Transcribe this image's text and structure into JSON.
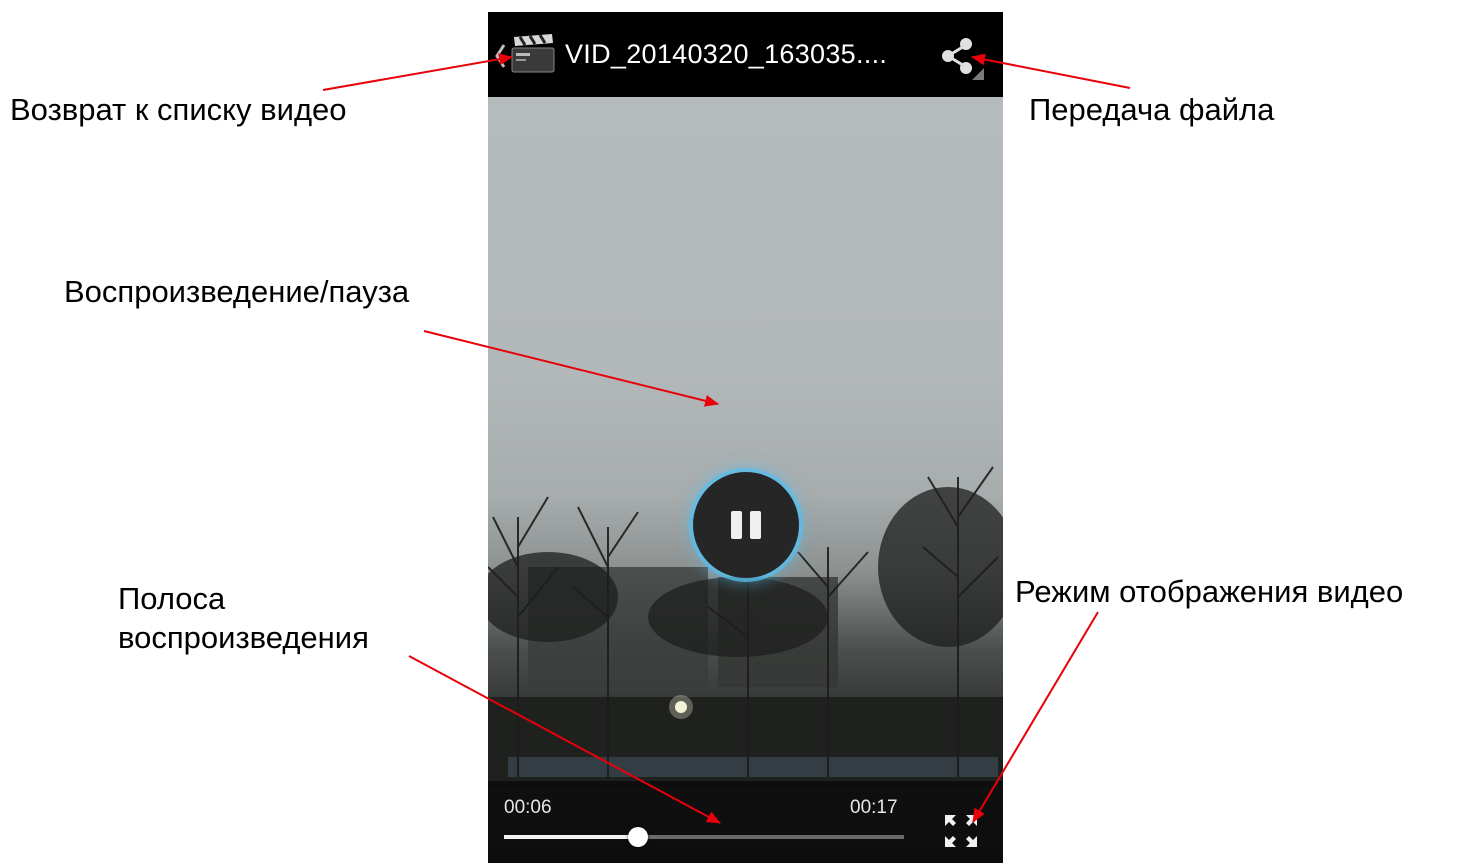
{
  "player": {
    "title": "VID_20140320_163035....",
    "time_elapsed": "00:06",
    "time_total": "00:17",
    "progress": 0.335
  },
  "callouts": {
    "back": "Возврат к списку видео",
    "share": "Передача файла",
    "play_pause": "Воспроизведение/пауза",
    "seekbar_line1": "Полоса",
    "seekbar_line2": "воспроизведения",
    "display_mode": "Режим отображения видео"
  },
  "colors": {
    "arrow": "#e8000b",
    "glow": "#5abeeb"
  },
  "icons": {
    "back": "back-chevron-icon",
    "app": "clapperboard-icon",
    "share": "share-icon",
    "play_pause": "pause-icon",
    "display_mode": "fullscreen-icon"
  }
}
